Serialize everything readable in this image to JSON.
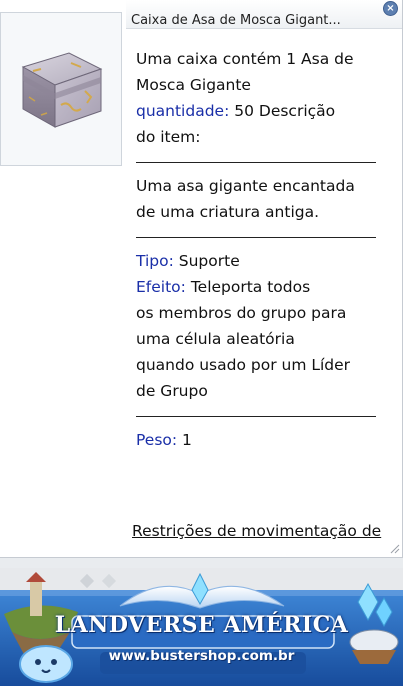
{
  "window": {
    "title": "Caixa de Asa de Mosca Gigant...",
    "close_icon": "close-icon",
    "item_icon": "gift-box-icon"
  },
  "item": {
    "description_line1": "Uma caixa contém 1 Asa de",
    "description_line2": "Mosca Gigante",
    "quantity_label": "quantidade:",
    "quantity_text": " 50 Descrição",
    "description_line4": "do item:",
    "flavor_line1": "Uma asa gigante encantada",
    "flavor_line2": "de uma criatura antiga.",
    "type_label": "Tipo:",
    "type_value": " Suporte",
    "effect_label": "Efeito:",
    "effect_line1": " Teleporta todos",
    "effect_line2": "os membros do grupo para",
    "effect_line3": "uma célula aleatória",
    "effect_line4": "quando usado por um Líder",
    "effect_line5": "de Grupo",
    "weight_label": "Peso:",
    "weight_value": " 1",
    "restrictions_text": "Restrições de movimentação de"
  },
  "banner": {
    "title": "LANDVERSE AMÉRICA",
    "url": "www.bustershop.com.br"
  },
  "colors": {
    "key_label": "#1a2fa8",
    "banner_bg": "#1f5fb3"
  }
}
